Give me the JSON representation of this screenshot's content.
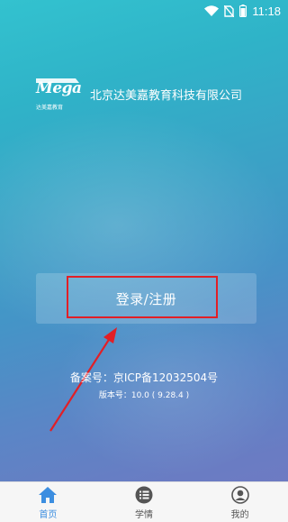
{
  "status_bar": {
    "time": "11:18",
    "icons": [
      "wifi-icon",
      "sim-off-icon",
      "battery-icon"
    ]
  },
  "brand": {
    "logo_text": "Mega",
    "logo_subtext": "达美嘉教育",
    "company_name": "北京达美嘉教育科技有限公司"
  },
  "login": {
    "label": "登录/注册",
    "highlight_color": "#e21f26"
  },
  "footer_info": {
    "record": "备案号：京ICP备12032504号",
    "version": "版本号：10.0 ( 9.28.4 )"
  },
  "tab_bar": {
    "active_color": "#3c8ee0",
    "tabs": [
      {
        "label": "首页",
        "icon": "home-icon",
        "active": true
      },
      {
        "label": "学情",
        "icon": "list-icon",
        "active": false
      },
      {
        "label": "我的",
        "icon": "profile-icon",
        "active": false
      }
    ]
  }
}
